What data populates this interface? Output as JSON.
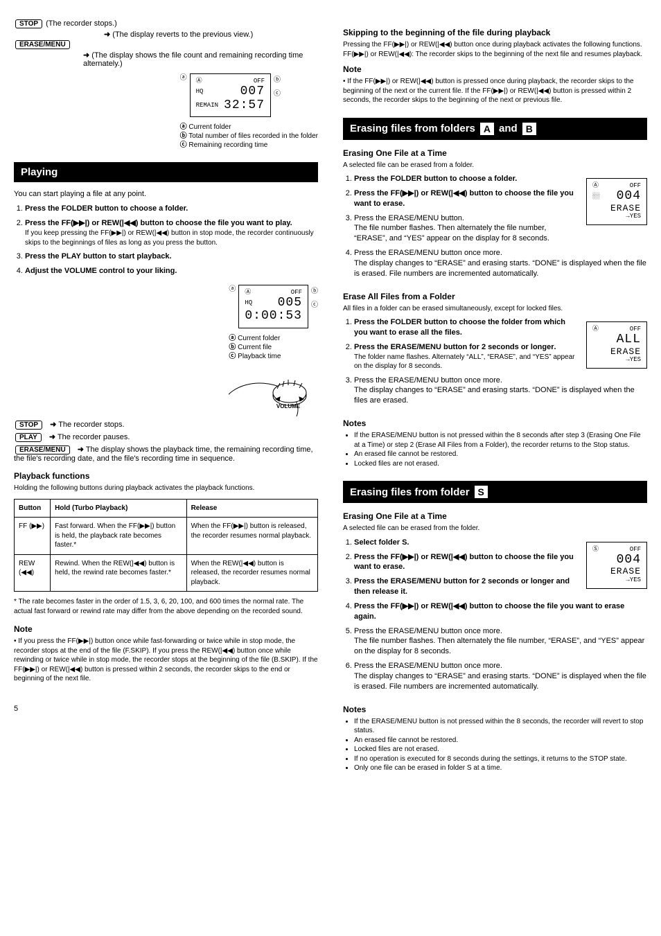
{
  "icons": {
    "next": "▶▶|",
    "prev": "|◀◀",
    "ff": "▶▶",
    "rew": "◀◀",
    "arrow": "➜"
  },
  "left": {
    "ladder1": {
      "stop_btn": "STOP",
      "stop_text": "(The recorder stops.)",
      "arr": "➜",
      "result": "(The display reverts to the previous view.)",
      "erase_btn": "ERASE/MENU",
      "erase_result": "(The display shows the file count and remaining recording time alternately.)"
    },
    "lcd1": {
      "a_tag": "ⓐ",
      "b_tag": "ⓑ",
      "c_tag": "ⓒ",
      "row1_l": "Ⓐ",
      "row1_r": "OFF",
      "row2_l": "HQ",
      "row2_r": "007",
      "row3_l": "REMAIN",
      "row3_r": "32:57",
      "a_desc": "Current folder",
      "b_desc": "Total number of files recorded in the folder",
      "c_desc": "Remaining recording time"
    },
    "play_bar": "Playing",
    "play_p1": "You can start playing a file at any point.",
    "play_steps": [
      {
        "head": "Press the FOLDER button to choose a folder.",
        "sub": ""
      },
      {
        "head": "Press the FF(▶▶|) or REW(|◀◀) button to choose the file you want to play.",
        "sub": "If you keep pressing the FF(▶▶|) or REW(|◀◀) button in stop mode, the recorder continuously skips to the beginnings of files as long as you press the button."
      },
      {
        "head": "Press the PLAY button to start playback.",
        "sub": ""
      },
      {
        "head": "Adjust the VOLUME control to your liking.",
        "sub": ""
      }
    ],
    "lcd2": {
      "a_tag": "ⓐ",
      "b_tag": "ⓑ",
      "c_tag": "ⓒ",
      "row1_l": "Ⓐ",
      "row1_r": "OFF",
      "row2_l": "HQ",
      "row2_r": "005",
      "row3": "0:00:53",
      "a_desc": "Current folder",
      "b_desc": "Current file",
      "c_desc": "Playback time"
    },
    "volume_label": "VOLUME",
    "ladder2": {
      "stop_btn": "STOP",
      "stop_text": "The recorder stops.",
      "play_btn": "PLAY",
      "play_text": "The recorder pauses.",
      "erase_btn": "ERASE/MENU",
      "erase_text": "The display shows the playback time, the remaining recording time, the file's recording date, and the file's recording time in sequence."
    },
    "play_funcs": "Playback functions",
    "funcs_intro": "Holding the following buttons during playback activates the playback functions.",
    "table": {
      "h1": "Button",
      "h2": "Hold (Turbo Playback)",
      "h3": "Release",
      "r1c1": "FF (▶▶)",
      "r1c2": "Fast forward. When the FF(▶▶|) button is held, the playback rate becomes faster.*",
      "r1c3": "When the FF(▶▶|) button is released, the recorder resumes normal playback.",
      "r2c1": "REW (◀◀)",
      "r2c2": "Rewind. When the REW(|◀◀) button is held, the rewind rate becomes faster.*",
      "r2c3": "When the REW(|◀◀) button is released, the recorder resumes normal playback."
    },
    "asterisk": "* The rate becomes faster in the order of 1.5, 3, 6, 20, 100, and 600 times the normal rate. The actual fast forward or rewind rate may differ from the above depending on the recorded sound.",
    "note_h": "Note",
    "note_body": "• If you press the FF(▶▶|) button once while fast-forwarding or twice while in stop mode, the recorder stops at the end of the file (F.SKIP). If you press the REW(|◀◀) button once while rewinding or twice while in stop mode, the recorder stops at the beginning of the file (B.SKIP). If the FF(▶▶|) or REW(|◀◀) button is pressed within 2 seconds, the recorder skips to the end or beginning of the next file.",
    "pagenum": "5"
  },
  "right": {
    "skip_title": "Skipping to the beginning of the file during playback",
    "skip_body": "Pressing the FF(▶▶|) or REW(|◀◀) button once during playback activates the following functions. FF(▶▶|) or REW(|◀◀): The recorder skips to the beginning of the next file and resumes playback.",
    "skip_note_h": "Note",
    "skip_note": "• If the FF(▶▶|) or REW(|◀◀) button is pressed once during playback, the recorder skips to the beginning of the next or the current file. If the FF(▶▶|) or REW(|◀◀) button is pressed within 2 seconds, the recorder skips to the beginning of the next or previous file.",
    "erase_bar_pre": "Erasing files from folders ",
    "erase_bar_A": "A",
    "erase_bar_mid": " and ",
    "erase_bar_B": "B",
    "one_title": "Erasing One File at a Time",
    "one_intro": "A selected file can be erased from a folder.",
    "one_steps": [
      "Press the FOLDER button to choose a folder.",
      "Press the FF(▶▶|) or REW(|◀◀) button to choose the file you want to erase.",
      "Press the ERASE/MENU button.\nThe file number flashes. Then alternately the file number, “ERASE”, and “YES” appear on the display for 8 seconds.",
      "Press the ERASE/MENU button once more.\nThe display changes to “ERASE” and erasing starts. “DONE” is displayed when the file is erased. File numbers are incremented automatically."
    ],
    "lcd_one": {
      "row1_l": "Ⓐ",
      "row1_r": "OFF",
      "dots": "░░",
      "num": "004",
      "erase": "ERASE",
      "yes": "→YES"
    },
    "all_title": "Erase All Files from a Folder",
    "all_intro": "All files in a folder can be erased simultaneously, except for locked files.",
    "all_steps": [
      "Press the FOLDER button to choose the folder from which you want to erase all the files.",
      "Press the ERASE/MENU button for 2 seconds or longer.\nThe folder name flashes. Alternately “ALL”, “ERASE”, and “YES” appear on the display for 8 seconds.",
      "Press the ERASE/MENU button once more.\nThe display changes to “ERASE” and erasing starts. “DONE” is displayed when the files are erased."
    ],
    "bold_2sec": "2 seconds or longer",
    "lcd_all": {
      "row1_l": "Ⓐ",
      "row1_r": "OFF",
      "all": "ALL",
      "erase": "ERASE",
      "yes": "→YES"
    },
    "erase_notes_h": "Notes",
    "erase_notes": [
      "If the ERASE/MENU button is not pressed within the 8 seconds after step 3 (Erasing One File at a Time) or step 2 (Erase All Files from a Folder), the recorder returns to the Stop status.",
      "An erased file cannot be restored.",
      "Locked files are not erased."
    ],
    "s_bar_pre": "Erasing files from folder ",
    "s_bar_S": "S",
    "s_one_h": "Erasing One File at a Time",
    "s_one_intro": "A selected file can be erased from the folder.",
    "s_steps": [
      "Select folder S.",
      "Press the FF(▶▶|) or REW(|◀◀) button to choose the file you want to erase.",
      "Press the ERASE/MENU button for 2 seconds or longer and then release it.",
      "Press the FF(▶▶|) or REW(|◀◀) button to choose the file you want to erase again.",
      "Press the ERASE/MENU button once more.\nThe file number flashes. Then alternately the file number, “ERASE”, and “YES” appear on the display for 8 seconds.",
      "Press the ERASE/MENU button once more.\nThe display changes to “ERASE” and erasing starts. “DONE” is displayed when the file is erased. File numbers are incremented automatically."
    ],
    "lcd_s": {
      "row1_l": "Ⓢ",
      "row1_r": "OFF",
      "num": "004",
      "erase": "ERASE",
      "yes": "→YES"
    },
    "s_notes_h": "Notes",
    "s_notes": [
      "If the ERASE/MENU button is not pressed within the 8 seconds, the recorder will revert to stop status.",
      "An erased file cannot be restored.",
      "Locked files are not erased.",
      "If no operation is executed for 8 seconds during the settings, it returns to the STOP state.",
      "Only one file can be erased in folder S at a time."
    ]
  }
}
